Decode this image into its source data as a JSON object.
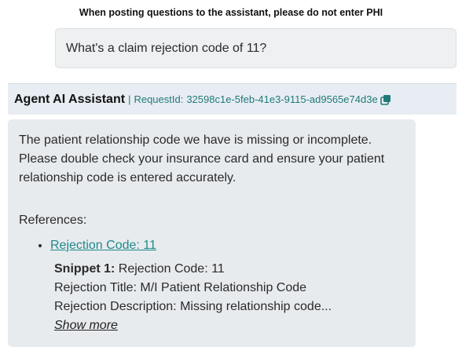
{
  "notice": "When posting questions to the assistant, please do not enter PHI",
  "user_message": "What's a claim rejection code of 11?",
  "agent": {
    "name": "Agent AI Assistant",
    "separator": "|",
    "request_label": "RequestId:",
    "request_id": "32598c1e-5feb-41e3-9115-ad9565e74d3e",
    "copy_icon": "copy-icon"
  },
  "response": {
    "answer": "The patient relationship code we have is missing or incomplete. Please double check your insurance card and ensure your patient relationship code is entered accurately.",
    "references_title": "References:",
    "references": [
      {
        "link_text": "Rejection Code: 11",
        "snippet_label": "Snippet 1:",
        "snippet_line1": "Rejection Code: 11",
        "snippet_line2": "Rejection Title: M/I Patient Relationship Code",
        "snippet_line3": "Rejection Description: Missing relationship code...",
        "show_more": "Show more"
      }
    ]
  },
  "colors": {
    "accent": "#1f8a8a",
    "bubble_bg": "#e8ebee",
    "header_bg": "#e8edf3"
  }
}
